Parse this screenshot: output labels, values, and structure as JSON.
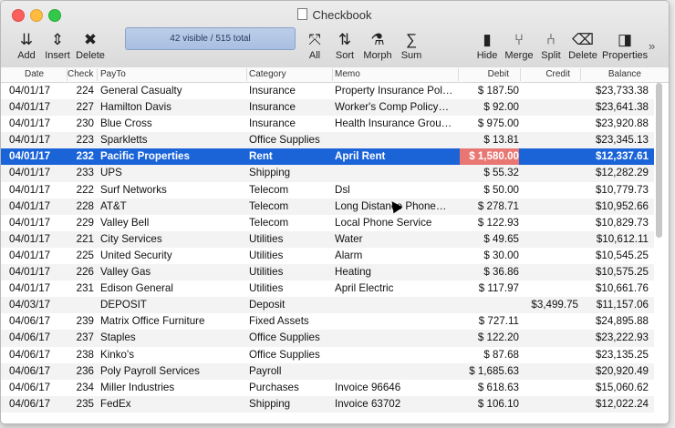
{
  "window": {
    "title": "Checkbook"
  },
  "toolbar": {
    "add": "Add",
    "insert": "Insert",
    "delete": "Delete",
    "status": "42 visible / 515 total",
    "all": "All",
    "sort": "Sort",
    "morph": "Morph",
    "sum": "Sum",
    "hide": "Hide",
    "merge": "Merge",
    "split": "Split",
    "delete2": "Delete",
    "properties": "Properties",
    "more": "»"
  },
  "columns": [
    "Date",
    "Check",
    "PayTo",
    "Category",
    "Memo",
    "Debit",
    "Credit",
    "Balance"
  ],
  "rows": [
    {
      "date": "04/01/17",
      "check": "224",
      "payto": "General Casualty",
      "category": "Insurance",
      "memo": "Property Insurance Pol…",
      "debit": "$ 187.50",
      "credit": "",
      "balance": "$23,733.38"
    },
    {
      "date": "04/01/17",
      "check": "227",
      "payto": "Hamilton Davis",
      "category": "Insurance",
      "memo": "Worker's Comp Policy…",
      "debit": "$ 92.00",
      "credit": "",
      "balance": "$23,641.38"
    },
    {
      "date": "04/01/17",
      "check": "230",
      "payto": "Blue Cross",
      "category": "Insurance",
      "memo": "Health Insurance Grou…",
      "debit": "$ 975.00",
      "credit": "",
      "balance": "$23,920.88"
    },
    {
      "date": "04/01/17",
      "check": "223",
      "payto": "Sparkletts",
      "category": "Office Supplies",
      "memo": "",
      "debit": "$ 13.81",
      "credit": "",
      "balance": "$23,345.13"
    },
    {
      "date": "04/01/17",
      "check": "232",
      "payto": "Pacific Properties",
      "category": "Rent",
      "memo": "April Rent",
      "debit": "$ 1,580.00",
      "credit": "",
      "balance": "$12,337.61"
    },
    {
      "date": "04/01/17",
      "check": "233",
      "payto": "UPS",
      "category": "Shipping",
      "memo": "",
      "debit": "$ 55.32",
      "credit": "",
      "balance": "$12,282.29"
    },
    {
      "date": "04/01/17",
      "check": "222",
      "payto": "Surf Networks",
      "category": "Telecom",
      "memo": "Dsl",
      "debit": "$ 50.00",
      "credit": "",
      "balance": "$10,779.73"
    },
    {
      "date": "04/01/17",
      "check": "228",
      "payto": "AT&T",
      "category": "Telecom",
      "memo": "Long Distance Phone…",
      "debit": "$ 278.71",
      "credit": "",
      "balance": "$10,952.66"
    },
    {
      "date": "04/01/17",
      "check": "229",
      "payto": "Valley Bell",
      "category": "Telecom",
      "memo": "Local Phone Service",
      "debit": "$ 122.93",
      "credit": "",
      "balance": "$10,829.73"
    },
    {
      "date": "04/01/17",
      "check": "221",
      "payto": "City Services",
      "category": "Utilities",
      "memo": "Water",
      "debit": "$ 49.65",
      "credit": "",
      "balance": "$10,612.11"
    },
    {
      "date": "04/01/17",
      "check": "225",
      "payto": "United Security",
      "category": "Utilities",
      "memo": "Alarm",
      "debit": "$ 30.00",
      "credit": "",
      "balance": "$10,545.25"
    },
    {
      "date": "04/01/17",
      "check": "226",
      "payto": "Valley Gas",
      "category": "Utilities",
      "memo": "Heating",
      "debit": "$ 36.86",
      "credit": "",
      "balance": "$10,575.25"
    },
    {
      "date": "04/01/17",
      "check": "231",
      "payto": "Edison General",
      "category": "Utilities",
      "memo": "April Electric",
      "debit": "$ 117.97",
      "credit": "",
      "balance": "$10,661.76"
    },
    {
      "date": "04/03/17",
      "check": "",
      "payto": "DEPOSIT",
      "category": "Deposit",
      "memo": "",
      "debit": "",
      "credit": "$3,499.75",
      "balance": "$11,157.06"
    },
    {
      "date": "04/06/17",
      "check": "239",
      "payto": "Matrix Office Furniture",
      "category": "Fixed Assets",
      "memo": "",
      "debit": "$ 727.11",
      "credit": "",
      "balance": "$24,895.88"
    },
    {
      "date": "04/06/17",
      "check": "237",
      "payto": "Staples",
      "category": "Office Supplies",
      "memo": "",
      "debit": "$ 122.20",
      "credit": "",
      "balance": "$23,222.93"
    },
    {
      "date": "04/06/17",
      "check": "238",
      "payto": "Kinko's",
      "category": "Office Supplies",
      "memo": "",
      "debit": "$ 87.68",
      "credit": "",
      "balance": "$23,135.25"
    },
    {
      "date": "04/06/17",
      "check": "236",
      "payto": "Poly Payroll Services",
      "category": "Payroll",
      "memo": "",
      "debit": "$ 1,685.63",
      "credit": "",
      "balance": "$20,920.49"
    },
    {
      "date": "04/06/17",
      "check": "234",
      "payto": "Miller Industries",
      "category": "Purchases",
      "memo": "Invoice 96646",
      "debit": "$ 618.63",
      "credit": "",
      "balance": "$15,060.62"
    },
    {
      "date": "04/06/17",
      "check": "235",
      "payto": "FedEx",
      "category": "Shipping",
      "memo": "Invoice 63702",
      "debit": "$ 106.10",
      "credit": "",
      "balance": "$12,022.24"
    }
  ],
  "selected_row": 4
}
